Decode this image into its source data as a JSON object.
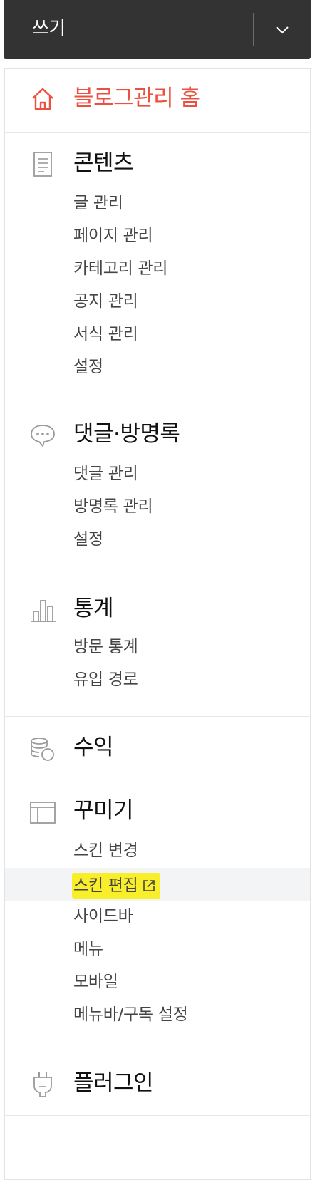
{
  "write": {
    "label": "쓰기"
  },
  "home": {
    "label": "블로그관리 홈",
    "color": "#eb5040"
  },
  "sections": {
    "contents": {
      "title": "콘텐츠",
      "items": [
        "글 관리",
        "페이지 관리",
        "카테고리 관리",
        "공지 관리",
        "서식 관리",
        "설정"
      ]
    },
    "comments": {
      "title": "댓글·방명록",
      "items": [
        "댓글 관리",
        "방명록 관리",
        "설정"
      ]
    },
    "stats": {
      "title": "통계",
      "items": [
        "방문 통계",
        "유입 경로"
      ]
    },
    "revenue": {
      "title": "수익"
    },
    "decorate": {
      "title": "꾸미기",
      "items": [
        "스킨 변경",
        "스킨 편집",
        "사이드바",
        "메뉴",
        "모바일",
        "메뉴바/구독 설정"
      ]
    },
    "plugin": {
      "title": "플러그인"
    }
  },
  "highlight_color": "#f9ee2a",
  "icons": [
    "home-icon",
    "document-icon",
    "speech-bubble-icon",
    "bar-chart-icon",
    "coins-icon",
    "layout-icon",
    "plug-icon",
    "external-link-icon",
    "chevron-down-icon"
  ]
}
